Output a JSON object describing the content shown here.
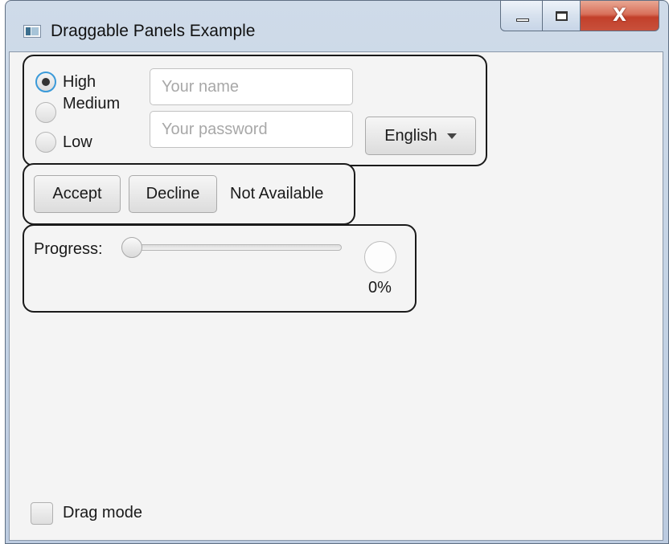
{
  "window": {
    "title": "Draggable Panels Example",
    "icon": "app-window-icon",
    "caption_buttons": {
      "minimize": "minimize-icon",
      "maximize": "maximize-icon",
      "close": "close-icon"
    },
    "close_glyph": "X"
  },
  "panel_input": {
    "radios": [
      {
        "label": "High",
        "checked": true
      },
      {
        "label": "Medium",
        "checked": false
      },
      {
        "label": "Low",
        "checked": false
      }
    ],
    "name_field": {
      "value": "",
      "placeholder": "Your name"
    },
    "password_field": {
      "value": "",
      "placeholder": "Your password"
    },
    "language_select": {
      "selected": "English",
      "icon": "chevron-down-icon"
    }
  },
  "panel_actions": {
    "accept_label": "Accept",
    "decline_label": "Decline",
    "status_text": "Not Available"
  },
  "panel_progress": {
    "label": "Progress:",
    "slider_value": 0,
    "percent_text": "0%",
    "progress_value": 0
  },
  "footer": {
    "drag_mode_label": "Drag mode",
    "drag_mode_checked": false
  },
  "colors": {
    "focus_ring": "#3a9ad9",
    "close_button": "#c8503c",
    "panel_border": "#1a1a1a",
    "client_background": "#f4f4f4"
  }
}
